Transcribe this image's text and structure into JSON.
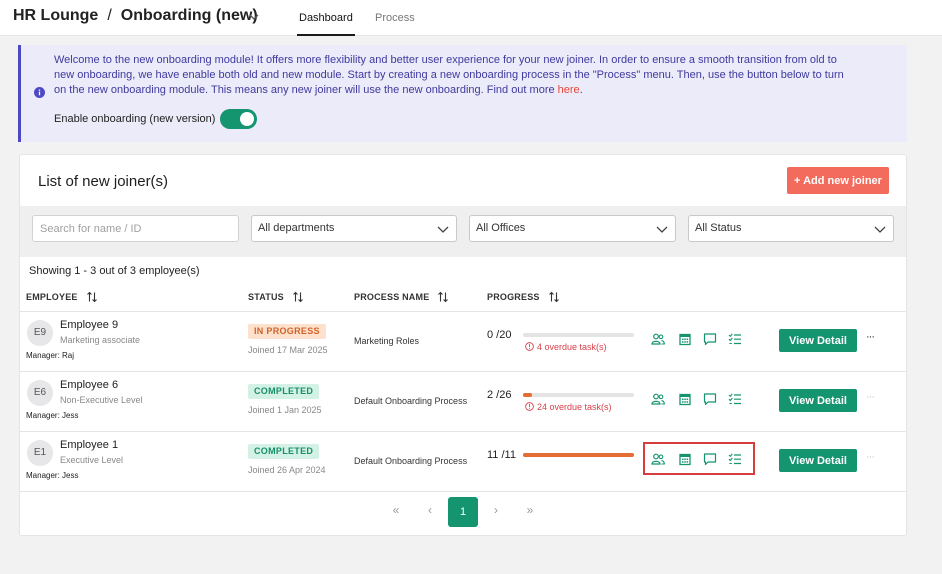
{
  "header": {
    "breadcrumb_root": "HR Lounge",
    "breadcrumb_sep": "/",
    "breadcrumb_current": "Onboarding (new)",
    "tabs": [
      {
        "label": "Dashboard",
        "active": true
      },
      {
        "label": "Process",
        "active": false
      }
    ]
  },
  "banner": {
    "text": "Welcome to the new onboarding module! It offers more flexibility and better user experience for your new joiner. In order to ensure a smooth transition from old to new onboarding, we have enable both old and new module. Start by creating a new onboarding process in the \"Process\" menu. Then, use the button below to turn on the new onboarding module. This means any new joiner will use the new onboarding. Find out more ",
    "link_text": "here",
    "link_suffix": ".",
    "toggle_label": "Enable onboarding (new version)",
    "toggle_on": true
  },
  "list": {
    "title": "List of new joiner(s)",
    "add_button": "+ Add new joiner",
    "search_placeholder": "Search for name / ID",
    "filters": {
      "department": "All departments",
      "office": "All Offices",
      "status": "All Status"
    },
    "showing": "Showing 1 - 3 out of 3 employee(s)",
    "columns": {
      "employee": "EMPLOYEE",
      "status": "STATUS",
      "process": "PROCESS NAME",
      "progress": "PROGRESS"
    },
    "rows": [
      {
        "initials": "E9",
        "name": "Employee 9",
        "role": "Marketing associate",
        "manager": "Manager: Raj",
        "status": "IN PROGRESS",
        "joined": "Joined 17 Mar 2025",
        "process": "Marketing Roles",
        "progress_text": "0 /20",
        "progress_fraction": 0,
        "overdue": "4 overdue task(s)",
        "view_label": "View Detail",
        "more": "···"
      },
      {
        "initials": "E6",
        "name": "Employee 6",
        "role": "Non-Executive Level",
        "manager": "Manager: Jess",
        "status": "COMPLETED",
        "joined": "Joined 1 Jan 2025",
        "process": "Default Onboarding Process",
        "progress_text": "2 /26",
        "progress_fraction": 0.077,
        "overdue": "24 overdue task(s)",
        "view_label": "View Detail",
        "more": "···"
      },
      {
        "initials": "E1",
        "name": "Employee 1",
        "role": "Executive Level",
        "manager": "Manager: Jess",
        "status": "COMPLETED",
        "joined": "Joined 26 Apr 2024",
        "process": "Default Onboarding Process",
        "progress_text": "11 /11",
        "progress_fraction": 1,
        "overdue": "",
        "view_label": "View Detail",
        "more": "···"
      }
    ],
    "pagination": {
      "first": "«",
      "prev": "‹",
      "current": "1",
      "next": "›",
      "last": "»"
    }
  },
  "colors": {
    "primary_green": "#14946f",
    "accent_orange": "#f26b5c",
    "banner_bg": "#ecebf9",
    "banner_border": "#4d49c5",
    "progress_fill": "#e36d35",
    "overdue_red": "#d8414b",
    "highlight_red": "#d93c3c"
  },
  "icons": [
    "info-icon",
    "chevron-down-icon",
    "sort-icon",
    "users-icon",
    "calendar-icon",
    "comment-icon",
    "checklist-icon",
    "alert-circle-icon"
  ]
}
